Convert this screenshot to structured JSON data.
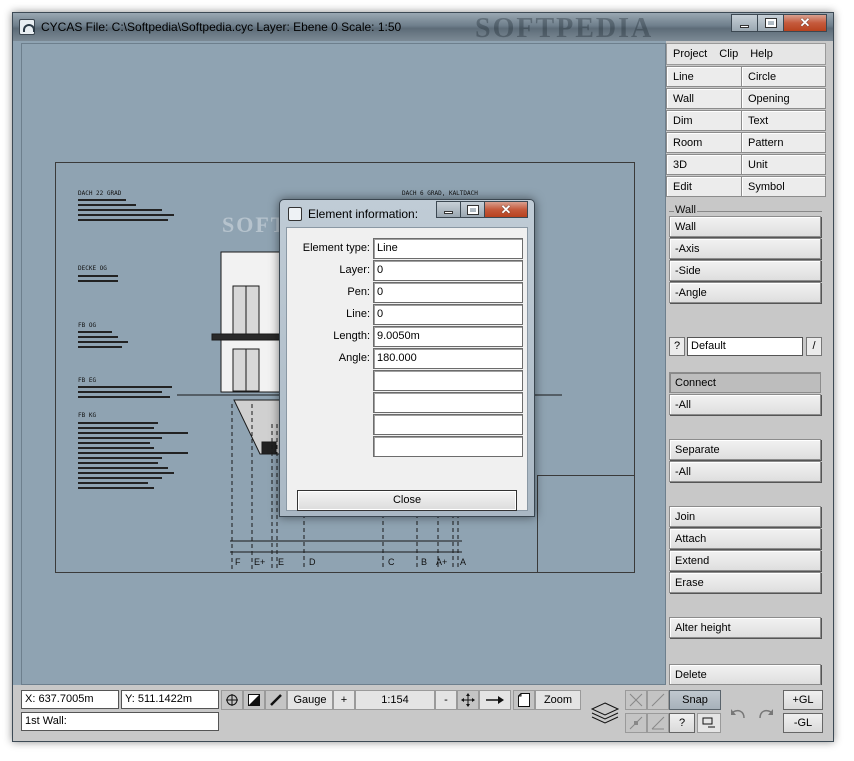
{
  "titlebar": {
    "title": "CYCAS  File: C:\\Softpedia\\Softpedia.cyc  Layer: Ebene 0  Scale: 1:50",
    "watermark": "SOFTPEDIA"
  },
  "drawing": {
    "watermark": "SOFTPEDIA",
    "labels": [
      "DACH 22 GRAD",
      "DACH 6 GRAD, KALTDACH",
      "DECKE OG",
      "FB OG",
      "FB EG",
      "FB KG"
    ],
    "axis_labels": [
      "F",
      "E+",
      "E",
      "D",
      "C",
      "B",
      "A+",
      "A"
    ]
  },
  "dialog": {
    "title": "Element information:",
    "fields": [
      {
        "label": "Element type:",
        "value": "Line"
      },
      {
        "label": "Layer:",
        "value": "0"
      },
      {
        "label": "Pen:",
        "value": "0"
      },
      {
        "label": "Line:",
        "value": "0"
      },
      {
        "label": "Length:",
        "value": "9.0050m"
      },
      {
        "label": "Angle:",
        "value": "180.000"
      },
      {
        "label": "",
        "value": ""
      },
      {
        "label": "",
        "value": ""
      },
      {
        "label": "",
        "value": ""
      },
      {
        "label": "",
        "value": ""
      }
    ],
    "close_label": "Close"
  },
  "panel": {
    "menu": [
      "Project",
      "Clip",
      "Help"
    ],
    "grid": [
      [
        "Line",
        "Circle"
      ],
      [
        "Wall",
        "Opening"
      ],
      [
        "Dim",
        "Text"
      ],
      [
        "Room",
        "Pattern"
      ],
      [
        "3D",
        "Unit"
      ],
      [
        "Edit",
        "Symbol"
      ]
    ],
    "section_label": "Wall",
    "buttons_top": [
      "Wall",
      "-Axis",
      "-Side",
      "-Angle"
    ],
    "question": "?",
    "combo_value": "Default",
    "slash": "/",
    "buttons_mid": [
      "Connect",
      "-All",
      "Separate",
      "-All"
    ],
    "buttons_bottom": [
      "Join",
      "Attach",
      "Extend",
      "Erase",
      "Alter height",
      "Delete"
    ]
  },
  "statusbar": {
    "x_coord": "X: 637.7005m",
    "y_coord": "Y: 511.1422m",
    "status_text": "1st Wall:",
    "gauge_label": "Gauge",
    "plus_label": "+",
    "scale_label": "1:154",
    "minus_label": "-",
    "zoom_label": "Zoom",
    "snap_label": "Snap",
    "question_label": "?",
    "plus_gl_label": "+GL",
    "minus_gl_label": "-GL"
  }
}
